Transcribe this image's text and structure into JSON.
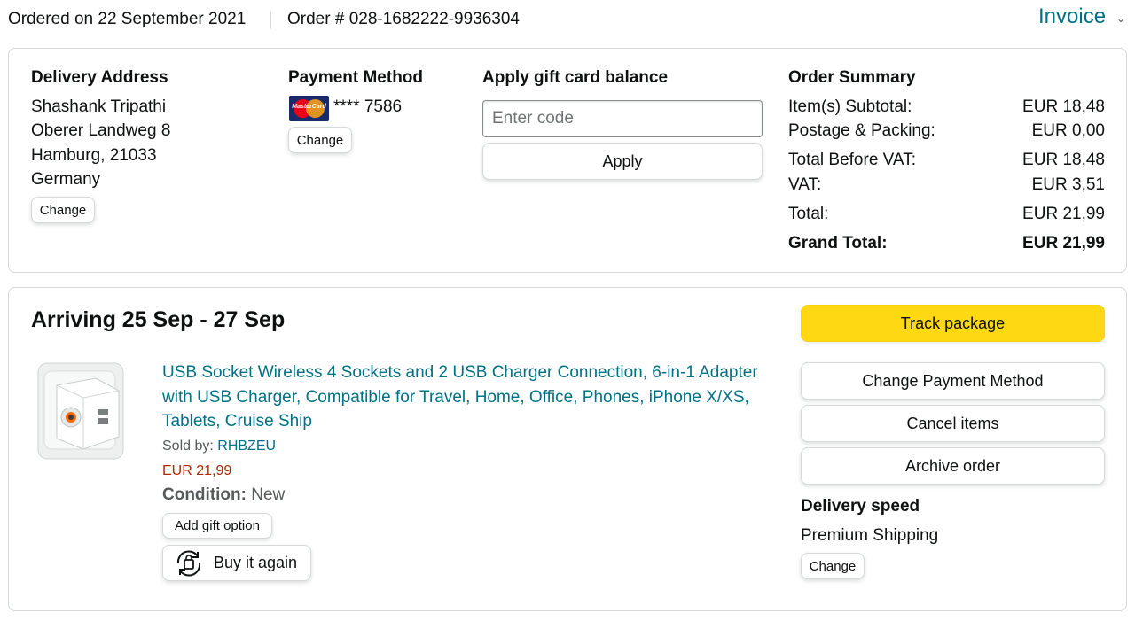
{
  "header": {
    "ordered_on": "Ordered on 22 September 2021",
    "order_number": "Order # 028-1682222-9936304",
    "invoice_label": "Invoice"
  },
  "delivery_address": {
    "heading": "Delivery Address",
    "lines": [
      "Shashank Tripathi",
      "Oberer Landweg 8",
      "Hamburg, 21033",
      "Germany"
    ],
    "change_label": "Change"
  },
  "payment_method": {
    "heading": "Payment Method",
    "card_masked": "**** 7586",
    "card_brand_text": "MasterCard",
    "change_label": "Change"
  },
  "gift_card": {
    "heading": "Apply gift card balance",
    "placeholder": "Enter code",
    "apply_label": "Apply"
  },
  "order_summary": {
    "heading": "Order Summary",
    "rows": [
      {
        "label": "Item(s) Subtotal:",
        "value": "EUR 18,48"
      },
      {
        "label": "Postage & Packing:",
        "value": "EUR 0,00"
      },
      {
        "label": "Total Before VAT:",
        "value": "EUR 18,48"
      },
      {
        "label": "VAT:",
        "value": "EUR 3,51"
      },
      {
        "label": "Total:",
        "value": "EUR 21,99"
      }
    ],
    "grand_total_label": "Grand Total:",
    "grand_total_value": "EUR 21,99"
  },
  "shipment": {
    "arriving": "Arriving 25 Sep - 27 Sep",
    "product_title": "USB Socket Wireless 4 Sockets and 2 USB Charger Connection, 6-in-1 Adapter with USB Charger, Compatible for Travel, Home, Office, Phones, iPhone X/XS, Tablets, Cruise Ship",
    "sold_by_label": "Sold by:",
    "seller": "RHBZEU",
    "price": "EUR 21,99",
    "condition_label": "Condition:",
    "condition_value": "New",
    "gift_option_label": "Add gift option",
    "buy_again_label": "Buy it again"
  },
  "actions": {
    "track_package": "Track package",
    "change_payment": "Change Payment Method",
    "cancel_items": "Cancel items",
    "archive_order": "Archive order",
    "delivery_speed_heading": "Delivery speed",
    "delivery_speed_value": "Premium Shipping",
    "change_label": "Change"
  },
  "colors": {
    "link": "#007185",
    "price": "#b12704",
    "track_button": "#ffd814",
    "border": "#d5d9d9"
  }
}
